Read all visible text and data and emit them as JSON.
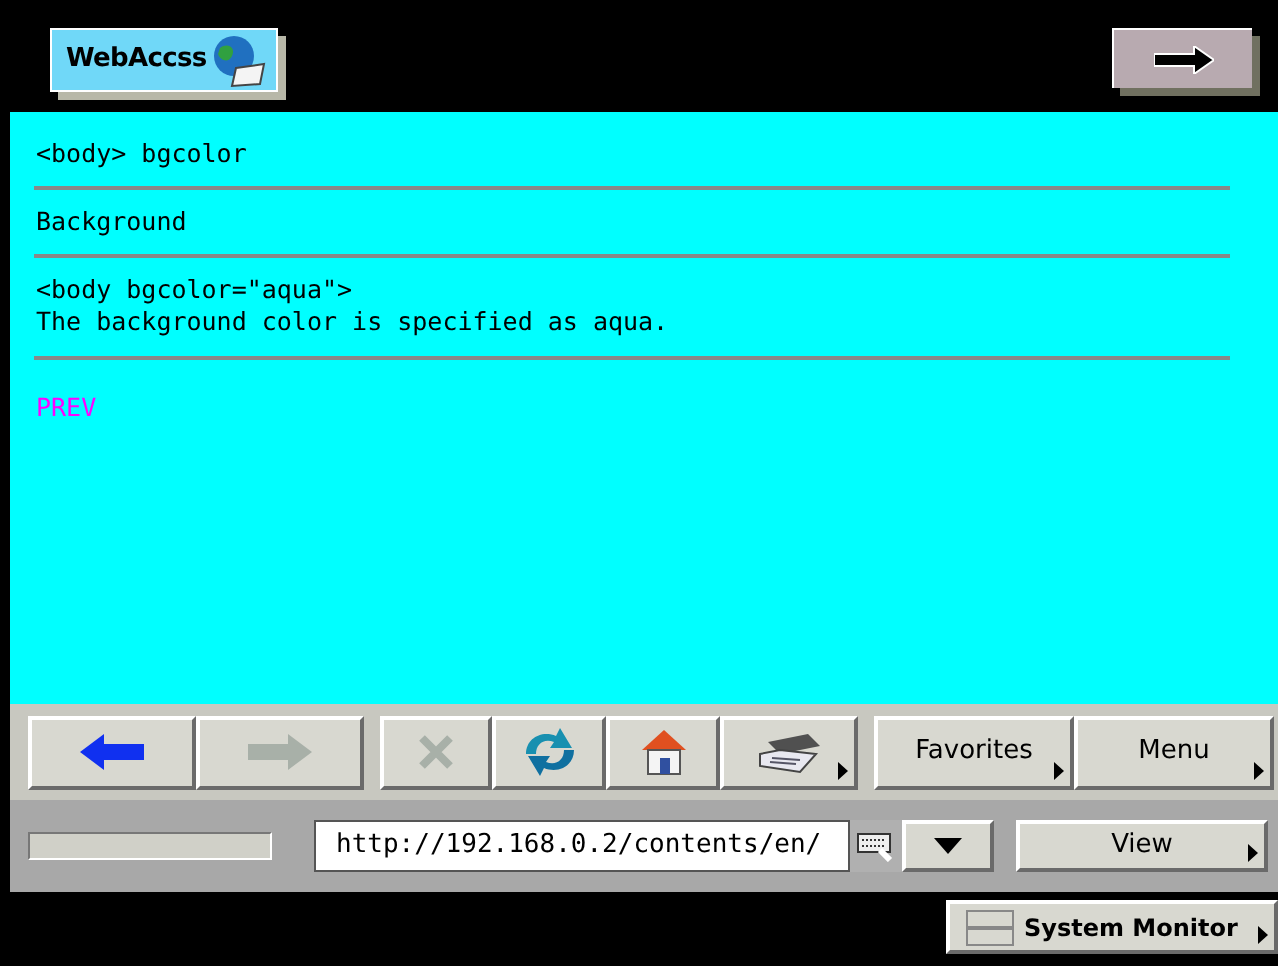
{
  "header": {
    "title": "WebAccss"
  },
  "content": {
    "heading": "<body> bgcolor",
    "section": "Background",
    "code": "<body bgcolor=\"aqua\">",
    "description": "The background color is specified as aqua.",
    "link": "PREV"
  },
  "toolbar": [
    {
      "kind": "back",
      "disabled": false
    },
    {
      "kind": "forward",
      "disabled": true
    },
    {
      "kind": "stop",
      "disabled": true
    },
    {
      "kind": "refresh",
      "disabled": false
    },
    {
      "kind": "home",
      "disabled": false
    },
    {
      "kind": "print",
      "disabled": false
    }
  ],
  "menus": [
    {
      "label": "Favorites"
    },
    {
      "label": "Menu"
    }
  ],
  "address": {
    "value": "http://192.168.0.2/contents/en/",
    "progress": {
      "level": 0
    }
  },
  "view_button": {
    "label": "View"
  },
  "system_monitor": {
    "label": "System Monitor"
  }
}
